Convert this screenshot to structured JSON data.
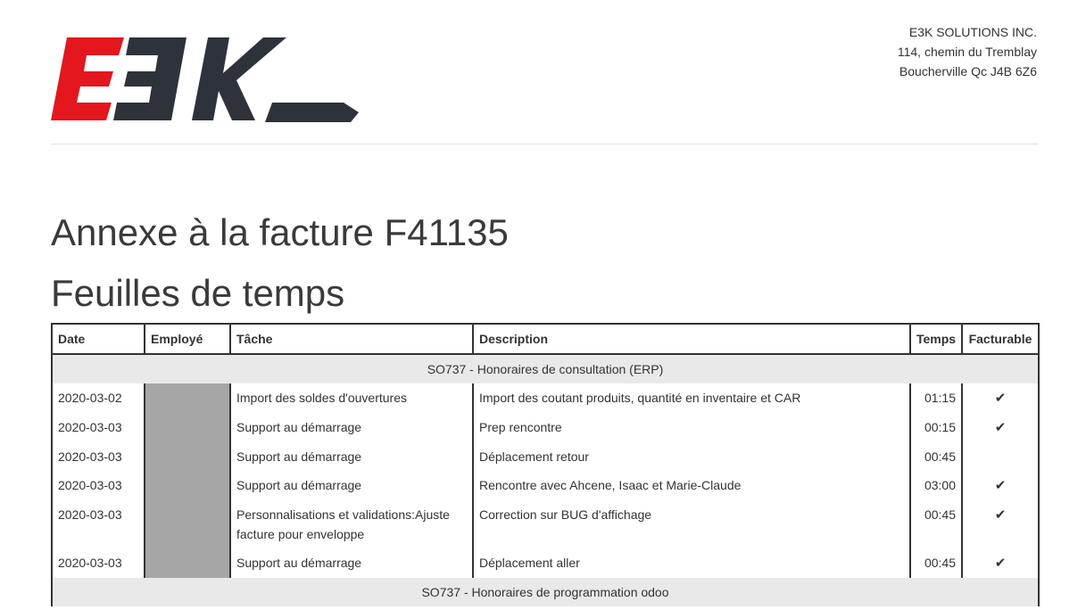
{
  "company": {
    "name": "E3K SOLUTIONS INC.",
    "street": "114, chemin du Tremblay",
    "city": "Boucherville Qc J4B 6Z6"
  },
  "logo": {
    "text": "E3K",
    "colors": {
      "red": "#e3171d",
      "dark": "#2e333b"
    }
  },
  "title": "Annexe à la facture F41135",
  "subtitle": "Feuilles de temps",
  "table": {
    "headers": {
      "date": "Date",
      "employee": "Employé",
      "task": "Tâche",
      "description": "Description",
      "time": "Temps",
      "billable": "Facturable"
    },
    "sections": [
      {
        "title": "SO737 - Honoraires de consultation (ERP)",
        "rows": [
          {
            "date": "2020-03-02",
            "task": "Import des soldes d'ouvertures",
            "description": "Import des coutant produits, quantité en inventaire et CAR",
            "time": "01:15",
            "billable": true
          },
          {
            "date": "2020-03-03",
            "task": "Support au démarrage",
            "description": "Prep rencontre",
            "time": "00:15",
            "billable": true
          },
          {
            "date": "2020-03-03",
            "task": "Support au démarrage",
            "description": "Déplacement retour",
            "time": "00:45",
            "billable": false
          },
          {
            "date": "2020-03-03",
            "task": "Support au démarrage",
            "description": "Rencontre avec Ahcene, Isaac et Marie-Claude",
            "time": "03:00",
            "billable": true
          },
          {
            "date": "2020-03-03",
            "task": "Personnalisations et validations:Ajuste facture pour enveloppe",
            "description": "Correction sur BUG d'affichage",
            "time": "00:45",
            "billable": true
          },
          {
            "date": "2020-03-03",
            "task": "Support au démarrage",
            "description": "Déplacement aller",
            "time": "00:45",
            "billable": true
          }
        ]
      },
      {
        "title": "SO737 - Honoraires de programmation odoo",
        "rows": []
      }
    ],
    "check_glyph": "✔"
  }
}
